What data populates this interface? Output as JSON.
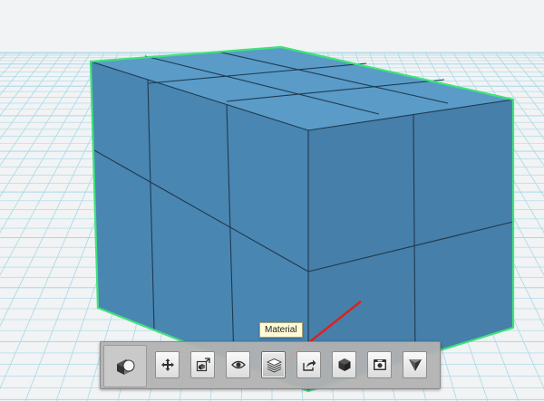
{
  "viewport": {
    "background": "#f1f3f4",
    "grid_color": "#a9d8e8",
    "cube_color": "#4a86b2",
    "cube_top_color": "#5a9bc8",
    "selection_outline_color": "#3fe27a",
    "annotation_arrow_color": "#e0201b"
  },
  "tooltip": {
    "text": "Material"
  },
  "toolbar": {
    "primary": {
      "icon": "object-shape-icon"
    },
    "buttons": [
      {
        "id": "move",
        "icon": "move-arrows-icon"
      },
      {
        "id": "scale",
        "icon": "smart-scale-icon"
      },
      {
        "id": "visibility",
        "icon": "eye-icon"
      },
      {
        "id": "material",
        "icon": "material-stack-icon",
        "active": true
      },
      {
        "id": "export",
        "icon": "export-arrow-icon"
      },
      {
        "id": "solid",
        "icon": "hexagon-solid-icon"
      },
      {
        "id": "snapshot",
        "icon": "snapshot-camera-icon"
      },
      {
        "id": "measure",
        "icon": "triangle-gem-icon"
      }
    ]
  }
}
